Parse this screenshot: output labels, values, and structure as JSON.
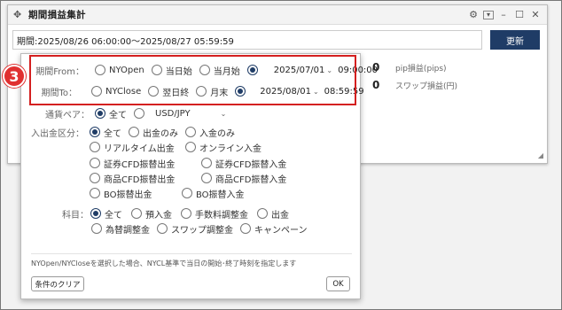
{
  "window": {
    "title": "期間損益集計",
    "icons": {
      "move": "move-icon",
      "settings": "gear-icon",
      "layout": "window-layout-icon",
      "minimize": "minimize-icon",
      "maximize": "maximize-icon",
      "close": "close-icon"
    },
    "period_text": "期間:2025/08/26 06:00:00〜2025/08/27 05:59:59",
    "update_label": "更新",
    "stats": [
      {
        "value": "0",
        "label": "pip損益(pips)"
      },
      {
        "value": "0",
        "label": "スワップ損益(円)"
      }
    ]
  },
  "annotation": {
    "badge": "3",
    "color": "#d42020"
  },
  "dialog": {
    "from": {
      "label": "期間From：",
      "options": [
        "NYOpen",
        "当日始",
        "当月始"
      ],
      "selected": 3,
      "date": "2025/07/01",
      "time": "09:00:00"
    },
    "to": {
      "label": "期間To：",
      "options": [
        "NYClose",
        "翌日終",
        "月末"
      ],
      "selected": 3,
      "date": "2025/08/01",
      "time": "08:59:59"
    },
    "pair": {
      "label": "通貨ペア：",
      "options": [
        "全て",
        "USD/JPY"
      ],
      "selected": 0
    },
    "deposit": {
      "label": "入出金区分：",
      "options": [
        "全て",
        "出金のみ",
        "入金のみ",
        "リアルタイム出金",
        "オンライン入金",
        "証券CFD振替出金",
        "証券CFD振替入金",
        "商品CFD振替出金",
        "商品CFD振替入金",
        "BO振替出金",
        "BO振替入金"
      ],
      "selected": 0
    },
    "subject": {
      "label": "科目：",
      "options": [
        "全て",
        "預入金",
        "手数料調整金",
        "出金",
        "為替調整金",
        "スワップ調整金",
        "キャンペーン"
      ],
      "selected": 0
    },
    "note": "NYOpen/NYCloseを選択した場合、NYCL基準で当日の開始･終了時刻を指定します",
    "clear_label": "条件のクリア",
    "ok_label": "OK"
  }
}
